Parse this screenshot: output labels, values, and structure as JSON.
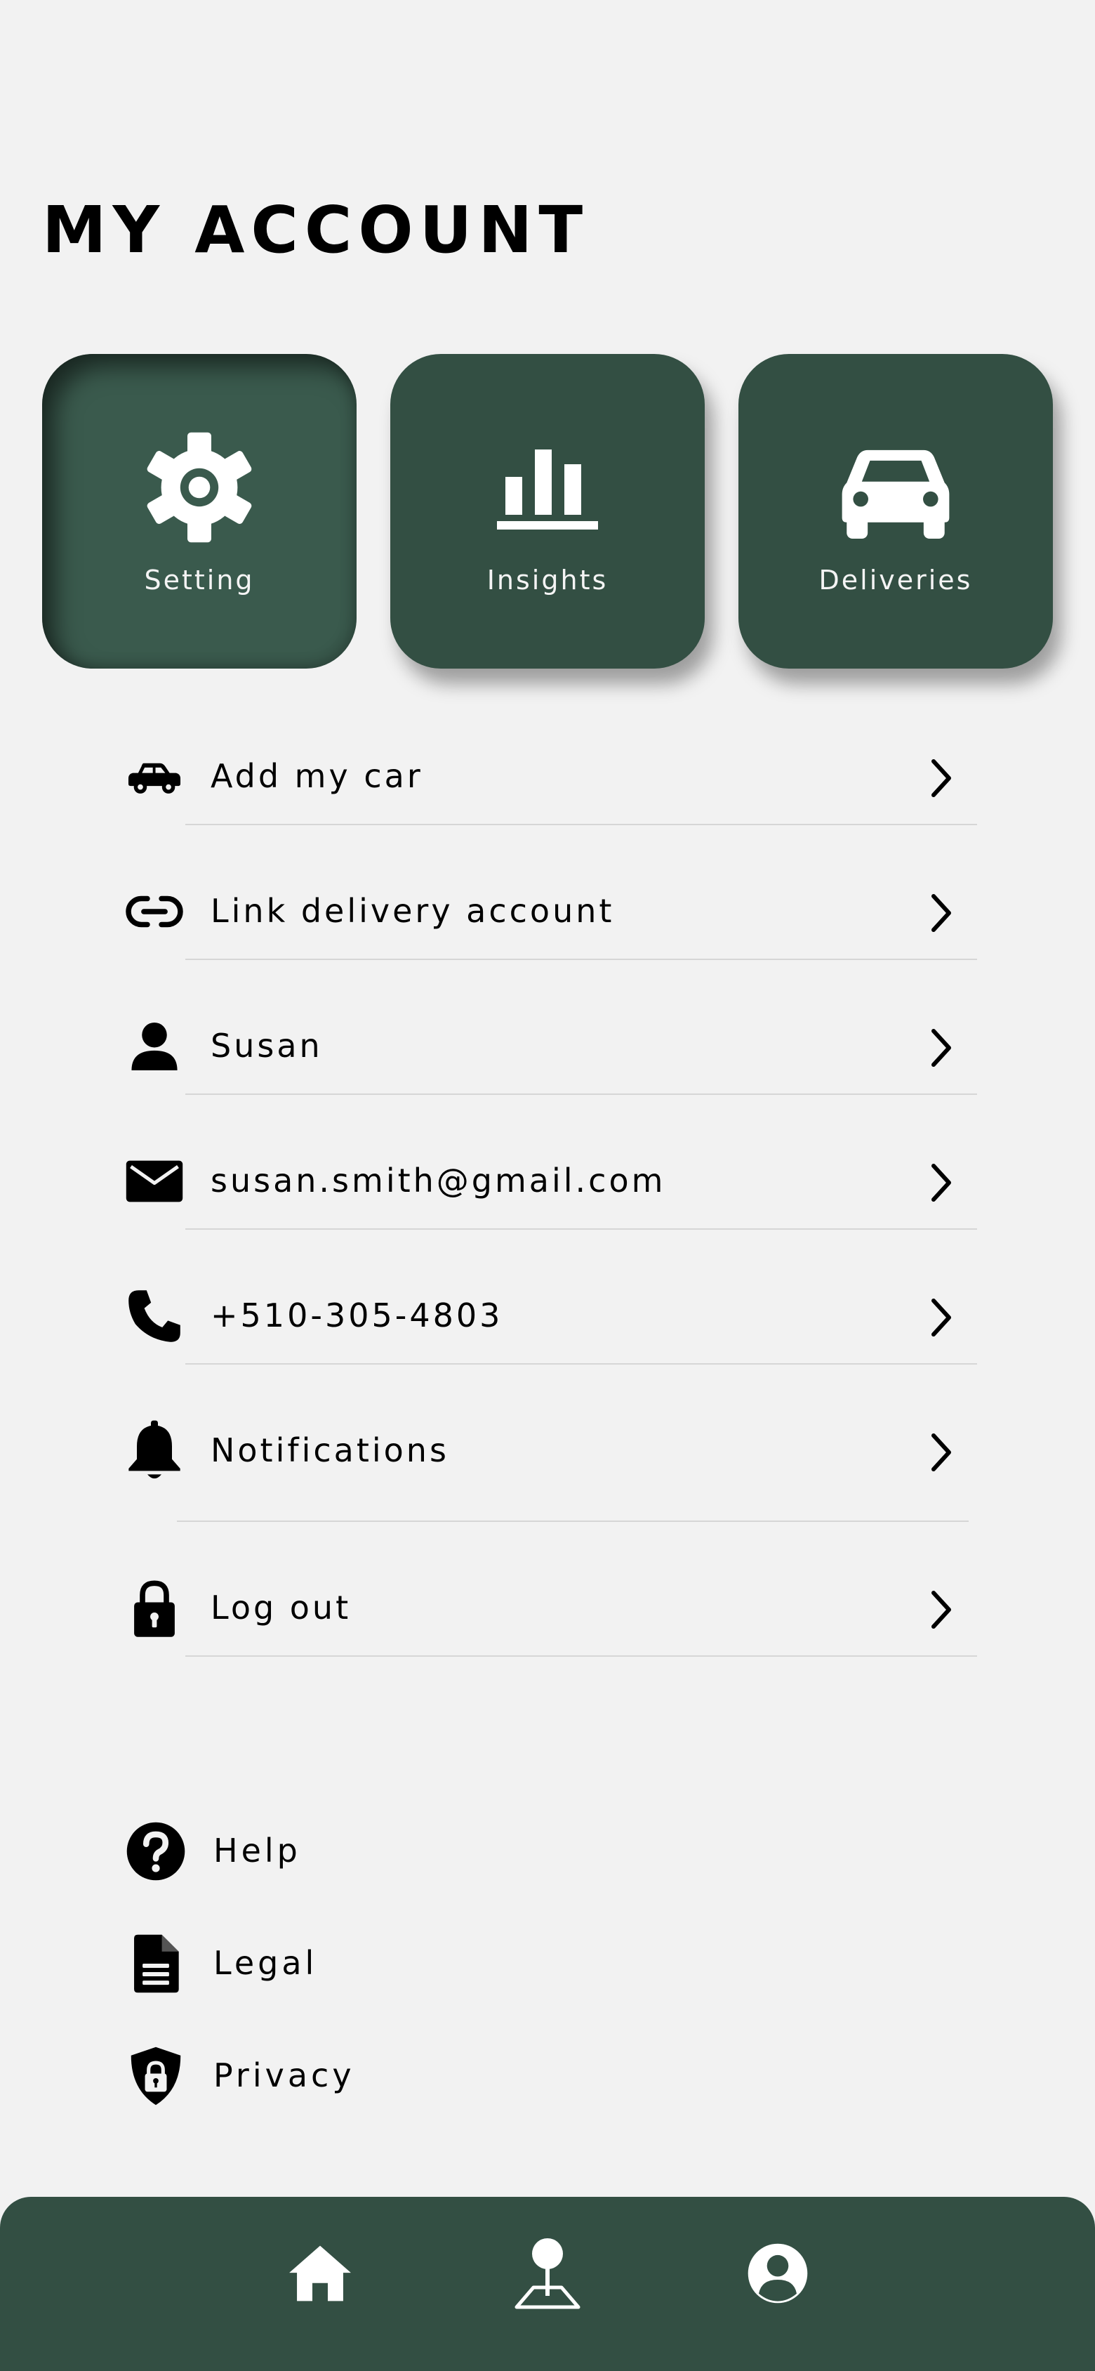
{
  "header": {
    "title": "MY ACCOUNT"
  },
  "tiles": [
    {
      "label": "Setting",
      "icon": "gear-icon",
      "state": "pressed"
    },
    {
      "label": "Insights",
      "icon": "bar-chart-icon",
      "state": "raised"
    },
    {
      "label": "Deliveries",
      "icon": "car-icon",
      "state": "raised"
    }
  ],
  "menu": {
    "items": [
      {
        "label": "Add my car",
        "icon": "car-side-icon"
      },
      {
        "label": "Link delivery account",
        "icon": "link-icon"
      },
      {
        "label": "Susan",
        "icon": "person-icon"
      },
      {
        "label": "susan.smith@gmail.com",
        "icon": "envelope-icon"
      },
      {
        "label": "+510-305-4803",
        "icon": "phone-icon"
      },
      {
        "label": "Notifications",
        "icon": "bell-icon"
      },
      {
        "label": "Log out",
        "icon": "lock-icon"
      }
    ]
  },
  "links": {
    "items": [
      {
        "label": "Help",
        "icon": "question-circle-icon"
      },
      {
        "label": "Legal",
        "icon": "document-icon"
      },
      {
        "label": "Privacy",
        "icon": "shield-lock-icon"
      }
    ]
  },
  "nav": {
    "items": [
      {
        "icon": "home-icon"
      },
      {
        "icon": "map-pin-icon"
      },
      {
        "icon": "profile-icon"
      }
    ]
  },
  "colors": {
    "brand": "#334f43",
    "background": "#f2f2f2",
    "text": "#000000",
    "divider": "#d6d6d6"
  }
}
